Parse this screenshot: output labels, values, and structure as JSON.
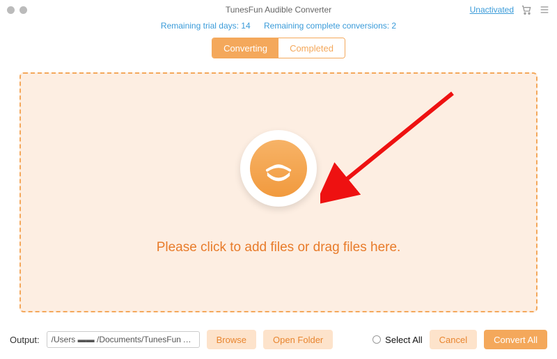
{
  "header": {
    "title": "TunesFun Audible Converter",
    "unactivated": "Unactivated"
  },
  "trial": {
    "days": "Remaining trial days: 14",
    "conversions": "Remaining complete conversions: 2"
  },
  "tabs": {
    "converting": "Converting",
    "completed": "Completed"
  },
  "dropzone": {
    "hint": "Please click to add files or drag files here."
  },
  "footer": {
    "output_label": "Output:",
    "output_path": "/Users ▬▬ /Documents/TunesFun Audibl...",
    "browse": "Browse",
    "open_folder": "Open Folder",
    "select_all": "Select All",
    "cancel": "Cancel",
    "convert_all": "Convert All"
  }
}
